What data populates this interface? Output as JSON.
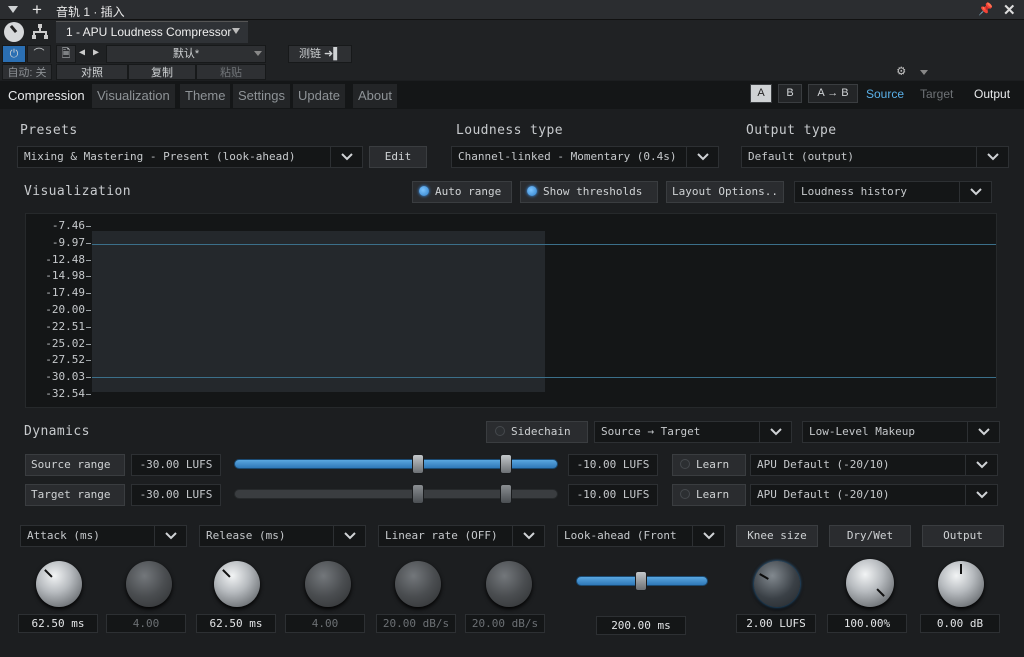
{
  "host": {
    "title": "音轨 1 · 插入",
    "plugin_name": "1 - APU Loudness Compressor",
    "preset_name": "默认*",
    "sidechain_label": "测链",
    "auto_label": "自动: 关",
    "compare_label": "对照",
    "copy_label": "复制",
    "paste_label": "粘贴"
  },
  "tabs": [
    "Compression",
    "Visualization",
    "Theme",
    "Settings",
    "Update",
    "About"
  ],
  "ab": {
    "a": "A",
    "b": "B",
    "atob": "A → B",
    "source": "Source",
    "target": "Target",
    "output": "Output"
  },
  "presets": {
    "label": "Presets",
    "value": "Mixing & Mastering - Present (look-ahead)",
    "edit": "Edit"
  },
  "loudness_type": {
    "label": "Loudness type",
    "value": "Channel-linked - Momentary (0.4s)"
  },
  "output_type": {
    "label": "Output type",
    "value": "Default (output)"
  },
  "visualization": {
    "label": "Visualization",
    "auto_range": "Auto range",
    "show_thresholds": "Show thresholds",
    "layout_options": "Layout Options..",
    "mode": "Loudness history",
    "ticks": [
      "-7.46",
      "-9.97",
      "-12.48",
      "-14.98",
      "-17.49",
      "-20.00",
      "-22.51",
      "-25.02",
      "-27.52",
      "-30.03",
      "-32.54"
    ]
  },
  "dynamics": {
    "label": "Dynamics",
    "sidechain": "Sidechain",
    "routing": "Source → Target",
    "makeup": "Low-Level Makeup",
    "source_range": {
      "label": "Source range",
      "low": "-30.00 LUFS",
      "high": "-10.00 LUFS",
      "learn": "Learn",
      "preset": "APU Default (-20/10)"
    },
    "target_range": {
      "label": "Target range",
      "low": "-30.00 LUFS",
      "high": "-10.00 LUFS",
      "learn": "Learn",
      "preset": "APU Default (-20/10)"
    }
  },
  "params": {
    "attack": "Attack (ms)",
    "release": "Release (ms)",
    "linear_rate": "Linear rate (OFF)",
    "look_ahead": "Look-ahead (Front",
    "knee": "Knee size",
    "drywet": "Dry/Wet",
    "output": "Output"
  },
  "values": {
    "attack": "62.50 ms",
    "attack2": "4.00",
    "release": "62.50 ms",
    "release2": "4.00",
    "rate1": "20.00 dB/s",
    "rate2": "20.00 dB/s",
    "lookahead": "200.00 ms",
    "knee": "2.00 LUFS",
    "drywet": "100.00%",
    "output": "0.00 dB"
  },
  "colors": {
    "accent": "#3f9bff",
    "source": "#5ab0e8",
    "target": "#6e7276"
  }
}
